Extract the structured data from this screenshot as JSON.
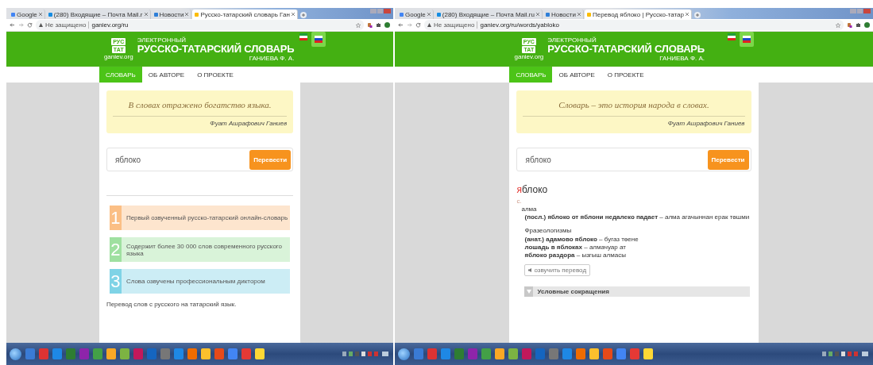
{
  "windows": [
    {
      "tabs": [
        {
          "title": "Google",
          "selected": false
        },
        {
          "title": "(280) Входящие – Почта Mail.r",
          "selected": false
        },
        {
          "title": "Новости",
          "selected": false
        },
        {
          "title": "Русско-татарский словарь Ган",
          "selected": true
        }
      ],
      "address": {
        "security": "Не защищено",
        "url": "ganiev.org/ru"
      },
      "site": {
        "logo_top": "РУС",
        "logo_bottom": "ТАТ",
        "logo_domain": "ganiev.org",
        "subtitle": "ЭЛЕКТРОННЫЙ",
        "title": "РУССКО-ТАТАРСКИЙ СЛОВАРЬ",
        "author": "ГАНИЕВА Ф. А.",
        "languages": [
          {
            "kind": "tatar",
            "selected": false
          },
          {
            "kind": "russian",
            "selected": true
          }
        ],
        "nav": [
          {
            "label": "СЛОВАРЬ",
            "selected": true
          },
          {
            "label": "ОБ АВТОРЕ",
            "selected": false
          },
          {
            "label": "О ПРОЕКТЕ",
            "selected": false
          }
        ]
      },
      "quote": {
        "text": "В словах отражено богатство языка.",
        "author": "Фуат Ашрафович Ганиев"
      },
      "search": {
        "value": "яблоко",
        "button": "Перевести"
      },
      "features": [
        {
          "number": "1",
          "text": "Первый озвученный русско-татарский онлайн-словарь",
          "color": "#fbbf85"
        },
        {
          "number": "2",
          "text": "Содержит более 30 000 слов современного русского языка",
          "color": "#9fe0a0"
        },
        {
          "number": "3",
          "text": "Слова озвучены профессиональным диктором",
          "color": "#7fd3e6"
        }
      ],
      "footer_note": "Перевод слов с русского на татарский язык."
    },
    {
      "tabs": [
        {
          "title": "Google",
          "selected": false
        },
        {
          "title": "(280) Входящие – Почта Mail.ru",
          "selected": false
        },
        {
          "title": "Новости",
          "selected": false
        },
        {
          "title": "Перевод яблоко | Русско-татар",
          "selected": true
        }
      ],
      "address": {
        "security": "Не защищено",
        "url": "ganiev.org/ru/words/yabloko"
      },
      "site": {
        "logo_top": "РУС",
        "logo_bottom": "ТАТ",
        "logo_domain": "ganiev.org",
        "subtitle": "ЭЛЕКТРОННЫЙ",
        "title": "РУССКО-ТАТАРСКИЙ СЛОВАРЬ",
        "author": "ГАНИЕВА Ф. А.",
        "languages": [
          {
            "kind": "tatar",
            "selected": false
          },
          {
            "kind": "russian",
            "selected": true
          }
        ],
        "nav": [
          {
            "label": "СЛОВАРЬ",
            "selected": true
          },
          {
            "label": "ОБ АВТОРЕ",
            "selected": false
          },
          {
            "label": "О ПРОЕКТЕ",
            "selected": false
          }
        ]
      },
      "quote": {
        "text": "Словарь – это история народа в словах.",
        "author": "Фуат Ашрафович Ганиев"
      },
      "search": {
        "value": "яблоко",
        "button": "Перевести"
      },
      "entry": {
        "headword": "яблоко",
        "part_of_speech": "с.",
        "translation": "алма",
        "examples": [
          "**(посл.) яблоко от яблони недалеко падает** – алма агачыннан ерак төшми"
        ],
        "section": "Фразеологизмы",
        "idioms": [
          "**(анат.) адамово яблоко** – бугаз төене",
          "**лошадь в яблоках** – алмачуар ат",
          "**яблоко раздора** – ызгыш алмасы"
        ],
        "audio_button": "озвучить перевод",
        "abbreviations": "Условные сокращения"
      }
    }
  ]
}
